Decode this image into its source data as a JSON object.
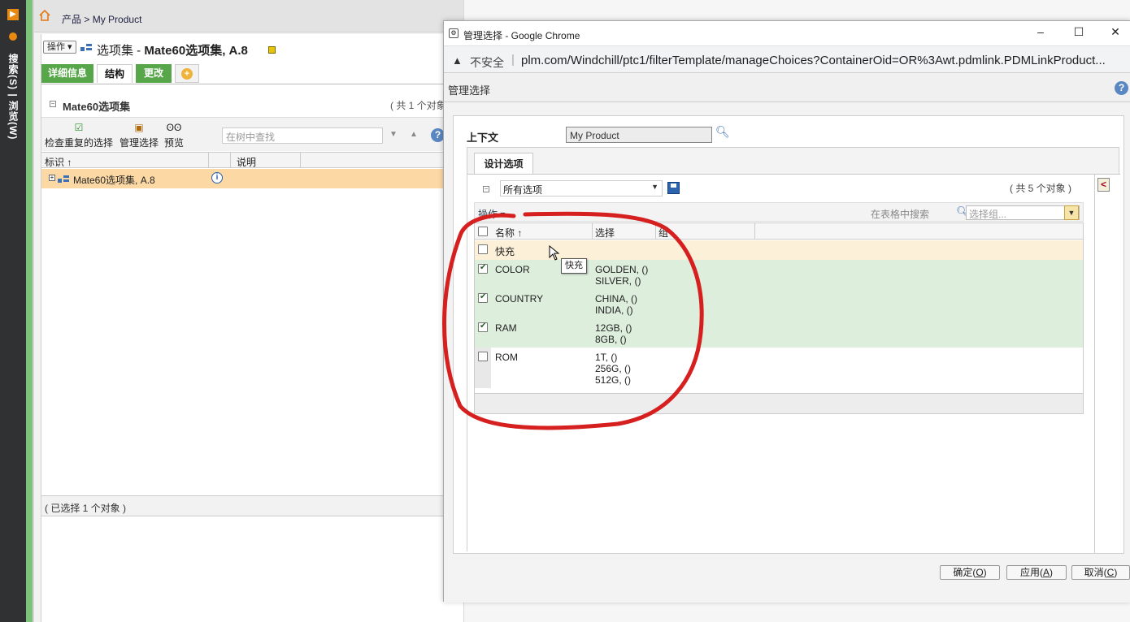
{
  "rail": {
    "label": "搜索(S) | 浏览(W)"
  },
  "breadcrumb": {
    "home": "产品",
    "sep": ">",
    "current": "My Product"
  },
  "page": {
    "ops_button": "操作",
    "title_prefix": "选项集 - ",
    "title_bold": "Mate60选项集, A.8",
    "tabs": {
      "details": "详细信息",
      "structure": "结构",
      "changes": "更改",
      "add": "+"
    }
  },
  "section": {
    "title": "Mate60选项集",
    "count": "( 共 1 个对象"
  },
  "toolbar": {
    "check_dup": "检查重复的选择",
    "manage": "管理选择",
    "preview": "预览",
    "tree_search_placeholder": "在树中查找"
  },
  "tree_grid": {
    "col_id": "标识 ↑",
    "col_desc": "说明",
    "row_label": "Mate60选项集, A.8",
    "status": "( 已选择 1 个对象 )"
  },
  "window": {
    "title": "管理选择 - Google Chrome",
    "minimize": "–",
    "maximize": "☐",
    "close": "✕",
    "insecure": "不安全",
    "url": "plm.com/Windchill/ptc1/filterTemplate/manageChoices?ContainerOid=OR%3Awt.pdmlink.PDMLinkProduct..."
  },
  "dialog": {
    "heading": "管理选择",
    "context_label": "上下文",
    "context_value": "My Product",
    "tab": "设计选项",
    "filter_value": "所有选项",
    "total": "( 共 5 个对象 )",
    "ops": "操作",
    "table_search_placeholder": "在表格中搜索",
    "group_placeholder": "选择组...",
    "columns": {
      "name": "名称 ↑",
      "choice": "选择",
      "group": "组"
    },
    "rows": [
      {
        "name": "快充",
        "choices": [],
        "checked": false
      },
      {
        "name": "COLOR",
        "choices": [
          "GOLDEN, ()",
          "SILVER, ()"
        ],
        "checked": true
      },
      {
        "name": "COUNTRY",
        "choices": [
          "CHINA, ()",
          "INDIA, ()"
        ],
        "checked": true
      },
      {
        "name": "RAM",
        "choices": [
          "12GB, ()",
          "8GB, ()"
        ],
        "checked": true
      },
      {
        "name": "ROM",
        "choices": [
          "1T, ()",
          "256G, ()",
          "512G, ()"
        ],
        "checked": false
      }
    ],
    "tooltip": "快充",
    "buttons": {
      "ok": "确定",
      "ok_key": "O",
      "apply": "应用",
      "apply_key": "A",
      "cancel": "取消",
      "cancel_key": "C"
    }
  },
  "colors": {
    "green_tab": "#57a64a",
    "selected_row": "#fcd9a4",
    "checked_row": "#ddeedd",
    "annotation": "#d61f1f"
  }
}
